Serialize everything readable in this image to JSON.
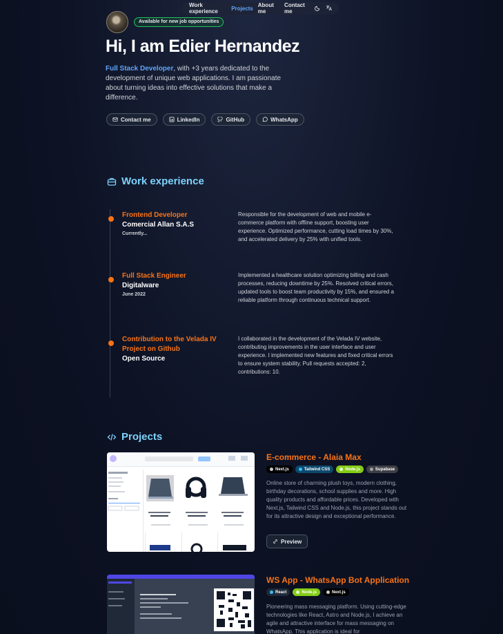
{
  "nav": {
    "items": [
      {
        "label": "Work experience",
        "active": false
      },
      {
        "label": "Projects",
        "active": true
      },
      {
        "label": "About me",
        "active": false
      },
      {
        "label": "Contact me",
        "active": false
      }
    ],
    "icons": [
      "moon-icon",
      "translate-icon"
    ]
  },
  "hero": {
    "badge": "Available for new job opportunities",
    "title": "Hi, I am Edier Hernandez",
    "highlight": "Full Stack Developer",
    "description": ", with +3 years dedicated to the development of unique web applications. I am passionate about turning ideas into effective solutions that make a difference.",
    "buttons": [
      {
        "label": "Contact me",
        "icon": "mail-icon"
      },
      {
        "label": "LinkedIn",
        "icon": "linkedin-icon"
      },
      {
        "label": "GitHub",
        "icon": "github-icon"
      },
      {
        "label": "WhatsApp",
        "icon": "whatsapp-icon"
      }
    ]
  },
  "experience": {
    "heading": "Work experience",
    "items": [
      {
        "role": "Frontend Developer",
        "company": "Comercial Allan S.A.S",
        "date": "Currently...",
        "description": "Responsible for the development of web and mobile e-commerce platform with offline support, boosting user experience. Optimized performance, cutting load times by 30%, and accelerated delivery by 25% with unified tools."
      },
      {
        "role": "Full Stack Engineer",
        "company": "Digitalware",
        "date": "June 2022",
        "description": "Implemented a healthcare solution optimizing billing and cash processes, reducing downtime by 25%. Resolved critical errors, updated tools to boost team productivity by 15%, and ensured a reliable platform through continuous technical support."
      },
      {
        "role": "Contribution to the Velada IV Project on Github",
        "company": "Open Source",
        "date": "",
        "description": "I collaborated in the development of the Velada IV website, contributing improvements in the user interface and user experience. I implemented new features and fixed critical errors to ensure system stability. Pull requests accepted: 2, contributions: 10."
      }
    ]
  },
  "projects": {
    "heading": "Projects",
    "items": [
      {
        "title": "E-commerce - Alaia Max",
        "tags": [
          {
            "label": "Next.js",
            "color": "#000000"
          },
          {
            "label": "Tailwind CSS",
            "color": "#0c4a6e"
          },
          {
            "label": "Node.js",
            "color": "#84cc16"
          },
          {
            "label": "Supabase",
            "color": "#3f3f46"
          }
        ],
        "description": "Online store of charming plush toys, modern clothing, birthday decorations, school supplies and more. High quality products and affordable prices. Developed with Next.js, Tailwind CSS and Node.js, this project stands out for its attractive design and exceptional performance.",
        "preview_label": "Preview"
      },
      {
        "title": "WS App - WhatsApp Bot Application",
        "tags": [
          {
            "label": "React",
            "color": "#1f2937"
          },
          {
            "label": "Node.js",
            "color": "#84cc16"
          },
          {
            "label": "Next.js",
            "color": "#000000"
          }
        ],
        "description": "Pioneering mass messaging platform. Using cutting-edge technologies like React, Astro and Node.js, I achieve an agile and attractive interface for mass messaging on WhatsApp. This application is ideal for",
        "preview_label": "Preview"
      }
    ]
  },
  "colors": {
    "accent_orange": "#f97316",
    "accent_blue": "#60a5fa",
    "heading_blue": "#7dd3fc",
    "background": "#0d1224"
  }
}
